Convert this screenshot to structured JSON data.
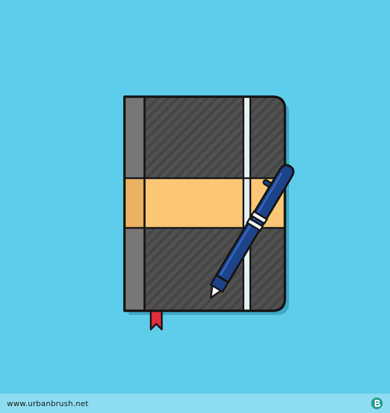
{
  "colors": {
    "background": "#5fcdea",
    "footer_bar": "#8ddcf1",
    "footer_text": "#1a1a1a",
    "logo_fill": "#2a9d8f",
    "outline": "#141414",
    "cover_dark": "#515151",
    "cover_stripe": "#454545",
    "spine": "#777777",
    "shadow": "#3fa9c6",
    "band": "#fcc675",
    "band_shade": "#e8b060",
    "elastic": "#e6f1f3",
    "bookmark": "#e32d3f",
    "pen_body": "#1d4389",
    "pen_highlight": "#3f6fcc",
    "pen_tip": "#ffffff"
  },
  "icons": {
    "illustration": "notebook-with-pen",
    "footer_logo": "urbanbrush-logo-icon"
  },
  "footer": {
    "website": "www.urbanbrush.net"
  }
}
